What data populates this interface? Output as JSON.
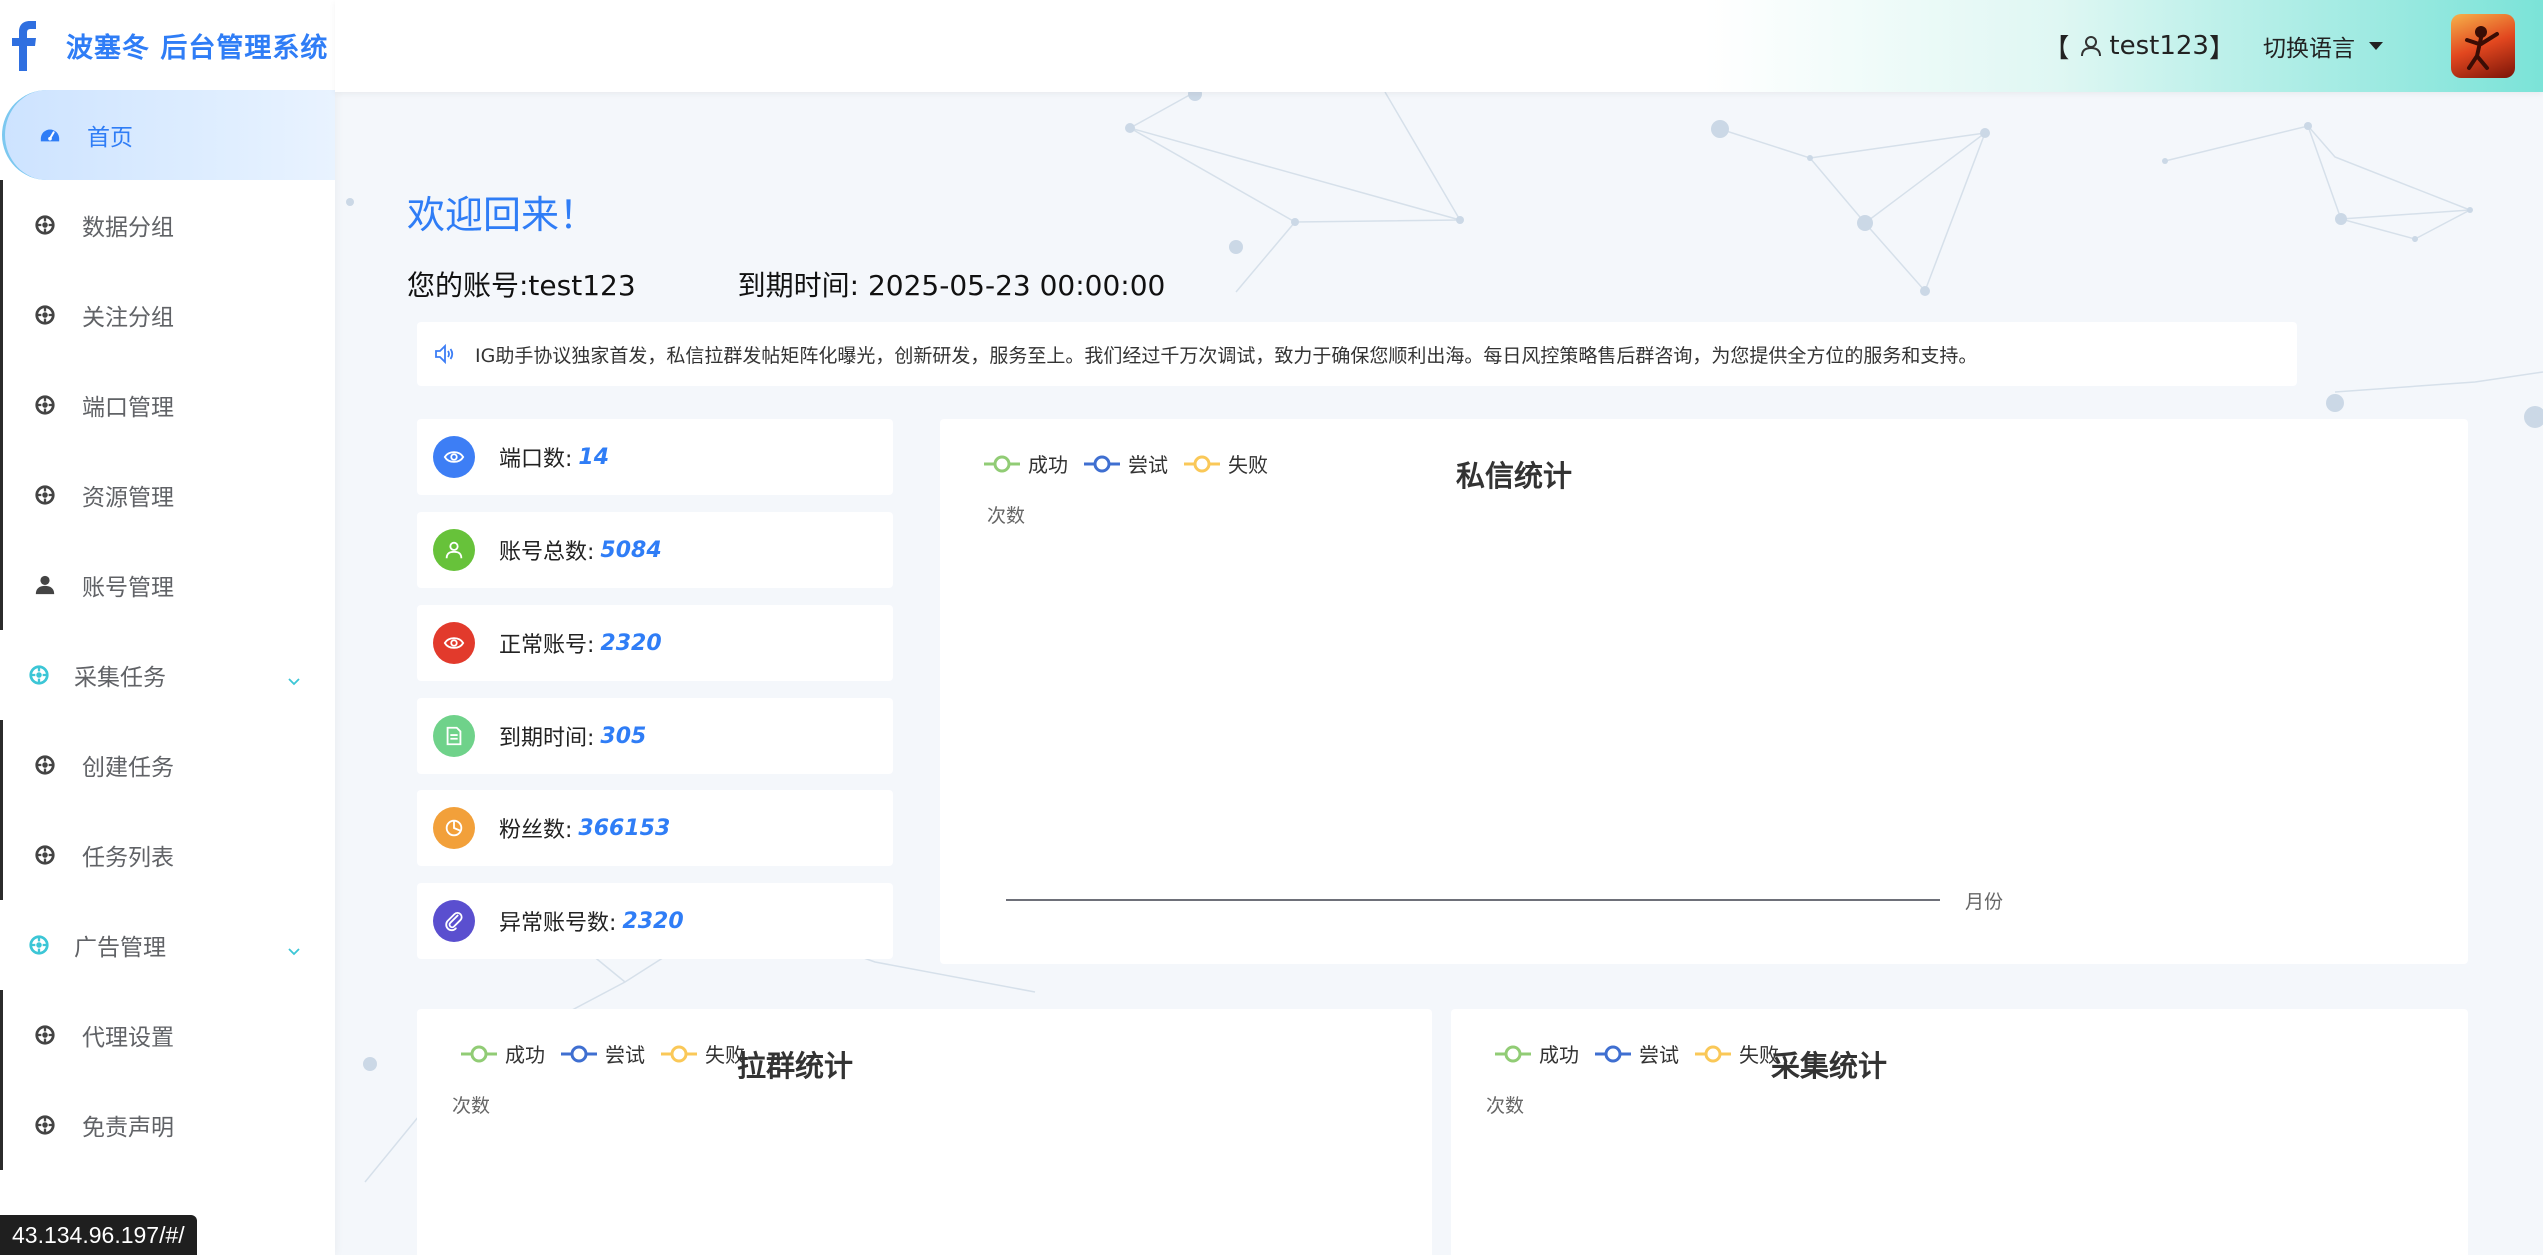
{
  "app": {
    "title": "波塞冬 后台管理系统",
    "logo_icon": "facebook-f-icon",
    "accent_color": "#2f7df6"
  },
  "sidebar": {
    "items": [
      {
        "label": "首页",
        "icon": "dashboard-icon",
        "active": true
      },
      {
        "label": "数据分组",
        "icon": "aperture-icon"
      },
      {
        "label": "关注分组",
        "icon": "aperture-icon"
      },
      {
        "label": "端口管理",
        "icon": "aperture-icon"
      },
      {
        "label": "资源管理",
        "icon": "aperture-icon"
      },
      {
        "label": "账号管理",
        "icon": "user-icon"
      },
      {
        "label": "采集任务",
        "icon": "aperture-icon",
        "group": true
      },
      {
        "label": "创建任务",
        "icon": "aperture-icon"
      },
      {
        "label": "任务列表",
        "icon": "aperture-icon"
      },
      {
        "label": "广告管理",
        "icon": "aperture-icon",
        "group": true
      },
      {
        "label": "代理设置",
        "icon": "aperture-icon"
      },
      {
        "label": "免责声明",
        "icon": "aperture-icon"
      }
    ]
  },
  "header": {
    "user_open": "【",
    "username": "test123",
    "user_close": "】",
    "language_label": "切换语言",
    "avatar_icon": "avatar-image"
  },
  "main": {
    "welcome": "欢迎回来！",
    "account_label": "您的账号:test123",
    "expire_label": "到期时间: 2025-05-23 00:00:00",
    "notice": "IG助手协议独家首发，私信拉群发帖矩阵化曝光，创新研发，服务至上。我们经过千万次调试，致力于确保您顺利出海。每日风控策略售后群咨询，为您提供全方位的服务和支持。"
  },
  "stats": [
    {
      "label": "端口数:",
      "value": "14",
      "color": "#3d7ef5",
      "icon": "eye-icon"
    },
    {
      "label": "账号总数:",
      "value": "5084",
      "color": "#67c23a",
      "icon": "user-icon"
    },
    {
      "label": "正常账号:",
      "value": "2320",
      "color": "#e23a2c",
      "icon": "eye-icon"
    },
    {
      "label": "到期时间:",
      "value": "305",
      "color": "#6fd28a",
      "icon": "document-icon"
    },
    {
      "label": "粉丝数:",
      "value": "366153",
      "color": "#f2a03a",
      "icon": "pie-chart-icon"
    },
    {
      "label": "异常账号数:",
      "value": "2320",
      "color": "#5a4fcf",
      "icon": "paperclip-icon"
    }
  ],
  "legend": [
    {
      "name": "成功",
      "color": "#91cc75"
    },
    {
      "name": "尝试",
      "color": "#3f6fd1"
    },
    {
      "name": "失败",
      "color": "#fac858"
    }
  ],
  "charts": {
    "dm": {
      "title": "私信统计",
      "yunit": "次数",
      "xunit": "月份"
    },
    "group": {
      "title": "拉群统计",
      "yunit": "次数"
    },
    "collect": {
      "title": "采集统计",
      "yunit": "次数"
    }
  },
  "chart_data": [
    {
      "type": "line",
      "title": "私信统计",
      "ylabel": "次数",
      "xlabel": "月份",
      "categories": [],
      "series": [
        {
          "name": "成功",
          "values": []
        },
        {
          "name": "尝试",
          "values": []
        },
        {
          "name": "失败",
          "values": []
        }
      ]
    },
    {
      "type": "line",
      "title": "拉群统计",
      "ylabel": "次数",
      "categories": [],
      "series": [
        {
          "name": "成功",
          "values": []
        },
        {
          "name": "尝试",
          "values": []
        },
        {
          "name": "失败",
          "values": []
        }
      ]
    },
    {
      "type": "line",
      "title": "采集统计",
      "ylabel": "次数",
      "categories": [],
      "series": [
        {
          "name": "成功",
          "values": []
        },
        {
          "name": "尝试",
          "values": []
        },
        {
          "name": "失败",
          "values": []
        }
      ]
    }
  ],
  "status_bar": {
    "url": "43.134.96.197/#/"
  }
}
